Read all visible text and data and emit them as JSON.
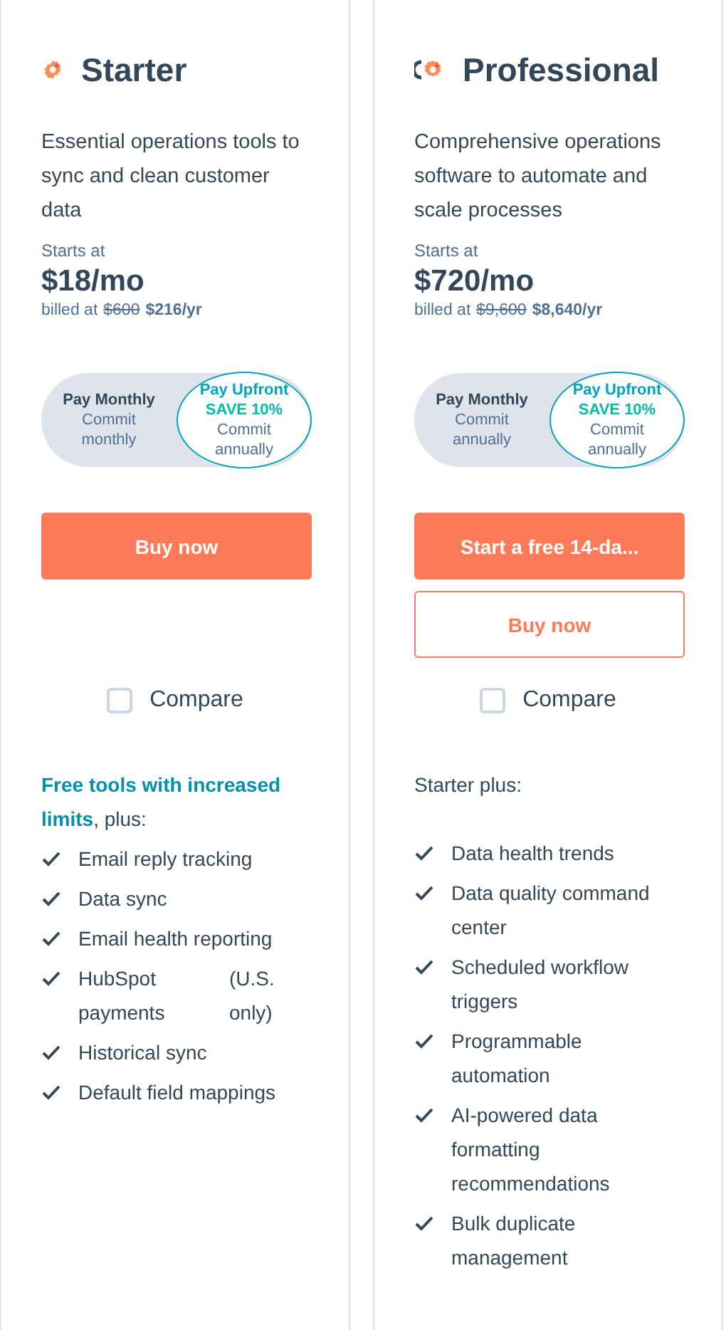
{
  "plans": [
    {
      "name": "Starter",
      "description": "Essential operations tools to sync and clean customer data",
      "starts_label": "Starts at",
      "price": "$18/mo",
      "billed_prefix": "billed at",
      "billed_old": "$600",
      "billed_new": "$216/yr",
      "toggle": [
        {
          "title": "Pay Monthly",
          "sub": "Commit monthly",
          "selected": false
        },
        {
          "title": "Pay Upfront",
          "save": "SAVE 10%",
          "sub": "Commit annually",
          "selected": true
        }
      ],
      "buttons": [
        {
          "label": "Buy now",
          "kind": "primary"
        }
      ],
      "compare": {
        "label": "Compare",
        "checked": false
      },
      "features_intro": "**Free tools with increased limits**, plus:",
      "features": [
        {
          "text": "Email reply tracking"
        },
        {
          "text": "Data sync"
        },
        {
          "text": "Email health reporting"
        },
        {
          "text": "HubSpot payments",
          "note": "(U.S. only)"
        },
        {
          "text": "Historical sync"
        },
        {
          "text": "Default field mappings"
        }
      ]
    },
    {
      "name": "Professional",
      "description": "Comprehensive operations software to automate and scale processes",
      "starts_label": "Starts at",
      "price": "$720/mo",
      "billed_prefix": "billed at",
      "billed_old": "$9,600",
      "billed_new": "$8,640/yr",
      "toggle": [
        {
          "title": "Pay Monthly",
          "sub": "Commit annually",
          "selected": false
        },
        {
          "title": "Pay Upfront",
          "save": "SAVE 10%",
          "sub": "Commit annually",
          "selected": true
        }
      ],
      "buttons": [
        {
          "label": "Start a free 14-da...",
          "kind": "primary"
        },
        {
          "label": "Buy now",
          "kind": "secondary"
        }
      ],
      "compare": {
        "label": "Compare",
        "checked": false
      },
      "features_intro": "Starter plus:",
      "features": [
        {
          "text": "Data health trends"
        },
        {
          "text": "Data quality command center"
        },
        {
          "text": "Scheduled workflow triggers"
        },
        {
          "text": "Programmable automation"
        },
        {
          "text": "AI-powered data formatting recommendations"
        },
        {
          "text": "Bulk duplicate management"
        }
      ]
    }
  ]
}
